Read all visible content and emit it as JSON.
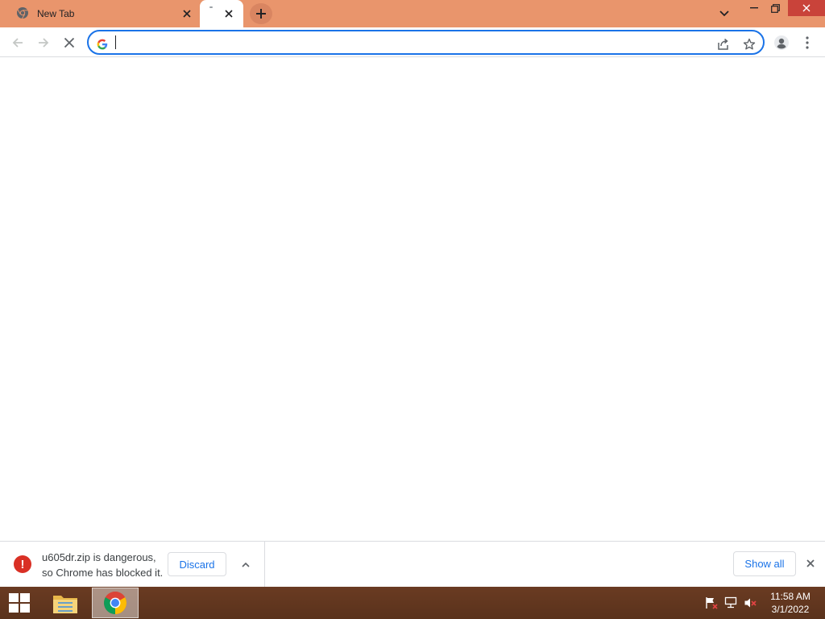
{
  "browser": {
    "tabs": [
      {
        "title": "New Tab",
        "icon": "chrome-icon",
        "active": false
      },
      {
        "title": "",
        "icon": "loading-icon",
        "active": true
      }
    ],
    "tabstrip_color": "#e9956c",
    "accent": "#1a73e8",
    "omnibox": {
      "value": "",
      "placeholder": ""
    }
  },
  "download_shelf": {
    "filename_line": "u605dr.zip is dangerous,",
    "message_line": "so Chrome has blocked it.",
    "discard_label": "Discard",
    "show_all_label": "Show all",
    "status_color": "#d93025"
  },
  "taskbar": {
    "time": "11:58 AM",
    "date": "3/1/2022",
    "apps": [
      "file-explorer-icon",
      "chrome-icon"
    ]
  }
}
